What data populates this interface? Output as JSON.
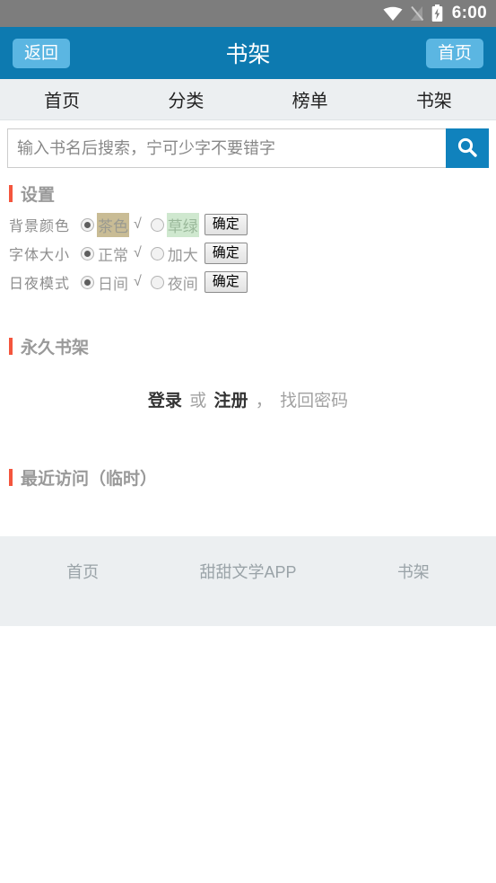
{
  "status_bar": {
    "time": "6:00",
    "icons": [
      "wifi-icon",
      "no-signal-icon",
      "battery-charging-icon"
    ]
  },
  "header": {
    "back_label": "返回",
    "title": "书架",
    "home_label": "首页",
    "bg_color": "#0d7ab0",
    "button_color": "#5bb6e2"
  },
  "nav": {
    "tabs": [
      {
        "label": "首页"
      },
      {
        "label": "分类"
      },
      {
        "label": "榜单"
      },
      {
        "label": "书架"
      }
    ]
  },
  "search": {
    "value": "",
    "placeholder": "输入书名后搜索，宁可少字不要错字",
    "button_icon": "search-icon",
    "button_color": "#1082bd"
  },
  "settings": {
    "title": "设置",
    "accent_color": "#f4553d",
    "rows": [
      {
        "label": "背景颜色",
        "option1": "茶色",
        "option1_swatch": "#c9bc95",
        "option1_selected": true,
        "check": "√",
        "option2": "草绿",
        "option2_swatch": "#cfe8cf",
        "option2_selected": false,
        "confirm": "确定"
      },
      {
        "label": "字体大小",
        "option1": "正常",
        "option1_selected": true,
        "check": "√",
        "option2": "加大",
        "option2_selected": false,
        "confirm": "确定"
      },
      {
        "label": "日夜模式",
        "option1": "日间",
        "option1_selected": true,
        "check": "√",
        "option2": "夜间",
        "option2_selected": false,
        "confirm": "确定"
      }
    ]
  },
  "permanent_shelf": {
    "title": "永久书架",
    "login_label": "登录",
    "or_label": "或",
    "register_label": "注册",
    "comma": "，",
    "forgot_label": "找回密码"
  },
  "recent": {
    "title": "最近访问（临时）"
  },
  "footer": {
    "items": [
      {
        "label": "首页"
      },
      {
        "label": "甜甜文学APP"
      },
      {
        "label": "书架"
      }
    ]
  }
}
